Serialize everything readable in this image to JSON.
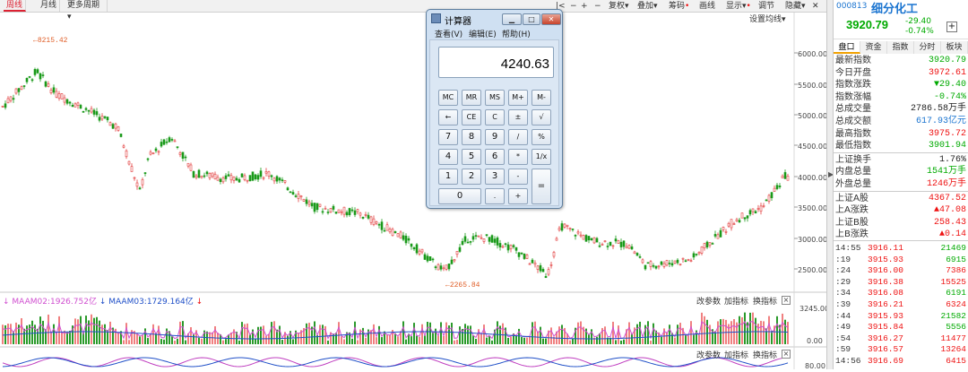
{
  "toolbar": {
    "period_tabs": [
      "周线",
      "月线"
    ],
    "more_period": "更多周期",
    "menus": [
      "复权",
      "叠加",
      "筹码",
      "画线",
      "显示",
      "调节",
      "隐藏"
    ],
    "settings_ma": "设置均线"
  },
  "chart": {
    "y_axis": [
      "6000.00",
      "5500.00",
      "5000.00",
      "4500.00",
      "4000.00",
      "3500.00",
      "3000.00",
      "2500.00"
    ],
    "high_label": "8215.42",
    "low_label": "2265.84"
  },
  "volume_panel": {
    "legend": [
      {
        "name": "MAAM02:1926.752亿",
        "color": "#d050d0"
      },
      {
        "name": "MAAM03:1729.164亿",
        "color": "#2050c8"
      }
    ],
    "y_axis": [
      "3245.00",
      "0.00"
    ],
    "buttons": [
      "改参数",
      "加指标",
      "换指标"
    ]
  },
  "indicator_panel": {
    "y_axis": [
      "80.00"
    ],
    "buttons": [
      "改参数",
      "加指标",
      "换指标"
    ]
  },
  "calculator": {
    "title": "计算器",
    "menu": [
      "查看(V)",
      "编辑(E)",
      "帮助(H)"
    ],
    "display": "4240.63",
    "keys": [
      [
        "MC",
        "MR",
        "MS",
        "M+",
        "M-"
      ],
      [
        "←",
        "CE",
        "C",
        "±",
        "√"
      ],
      [
        "7",
        "8",
        "9",
        "/",
        "%"
      ],
      [
        "4",
        "5",
        "6",
        "*",
        "1/x"
      ],
      [
        "1",
        "2",
        "3",
        "-",
        "="
      ],
      [
        "0",
        ".",
        "+"
      ]
    ]
  },
  "quote": {
    "code": "000813",
    "name": "细分化工",
    "price": "3920.79",
    "change": "-29.40",
    "change_pct": "-0.74%",
    "tabs": [
      "盘口",
      "资金",
      "指数",
      "分时",
      "板块"
    ],
    "rows": [
      {
        "label": "最新指数",
        "value": "3920.79",
        "color": "green"
      },
      {
        "label": "今日开盘",
        "value": "3972.61",
        "color": "red"
      },
      {
        "label": "指数涨跌",
        "value": "▼29.40",
        "color": "green"
      },
      {
        "label": "指数涨幅",
        "value": "-0.74%",
        "color": "green"
      },
      {
        "label": "总成交量",
        "value": "2786.58万手",
        "color": "black"
      },
      {
        "label": "总成交额",
        "value": "617.93亿元",
        "color": "blue"
      },
      {
        "label": "最高指数",
        "value": "3975.72",
        "color": "red"
      },
      {
        "label": "最低指数",
        "value": "3901.94",
        "color": "green"
      },
      {
        "label": "上证换手",
        "value": "1.76%",
        "color": "black"
      },
      {
        "label": "内盘总量",
        "value": "1541万手",
        "color": "green"
      },
      {
        "label": "外盘总量",
        "value": "1246万手",
        "color": "red"
      },
      {
        "label": "上证A股",
        "value": "4367.52",
        "color": "red"
      },
      {
        "label": "上A涨跌",
        "value": "▲47.08",
        "color": "red"
      },
      {
        "label": "上证B股",
        "value": "258.43",
        "color": "red"
      },
      {
        "label": "上B涨跌",
        "value": "▲0.14",
        "color": "red"
      }
    ],
    "ticks": [
      {
        "time": "14:55",
        "price": "3916.11",
        "vol": "21469",
        "color": "green"
      },
      {
        "time": ":19",
        "price": "3915.93",
        "vol": "6915",
        "color": "green"
      },
      {
        "time": ":24",
        "price": "3916.00",
        "vol": "7386",
        "color": "red"
      },
      {
        "time": ":29",
        "price": "3916.38",
        "vol": "15525",
        "color": "red"
      },
      {
        "time": ":34",
        "price": "3916.08",
        "vol": "6191",
        "color": "green"
      },
      {
        "time": ":39",
        "price": "3916.21",
        "vol": "6324",
        "color": "red"
      },
      {
        "time": ":44",
        "price": "3915.93",
        "vol": "21582",
        "color": "green"
      },
      {
        "time": ":49",
        "price": "3915.84",
        "vol": "5556",
        "color": "green"
      },
      {
        "time": ":54",
        "price": "3916.27",
        "vol": "11477",
        "color": "red"
      },
      {
        "time": ":59",
        "price": "3916.57",
        "vol": "13264",
        "color": "red"
      },
      {
        "time": "14:56",
        "price": "3916.69",
        "vol": "6415",
        "color": "red"
      }
    ]
  }
}
